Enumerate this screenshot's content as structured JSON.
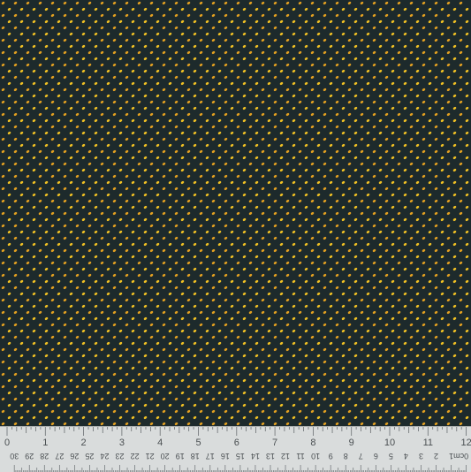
{
  "fabric": {
    "background_color": "#1d2a2c",
    "dot_colors": [
      "#e3a020",
      "#f0c023",
      "#d78d1c"
    ],
    "motif": "small-tilted-oval-dots"
  },
  "ruler": {
    "inch_labels": [
      "0",
      "1",
      "2",
      "3",
      "4",
      "5",
      "6",
      "7",
      "8",
      "9",
      "10",
      "11",
      "12"
    ],
    "cm_labels": [
      "30",
      "29",
      "28",
      "27",
      "26",
      "25",
      "24",
      "23",
      "22",
      "21",
      "20",
      "19",
      "18",
      "17",
      "16",
      "15",
      "14",
      "13",
      "12",
      "11",
      "10",
      "9",
      "8",
      "7",
      "6",
      "5",
      "4",
      "3",
      "2",
      "1",
      "0"
    ],
    "cm_unit": "cm",
    "background_color": "#d9dcdc"
  }
}
